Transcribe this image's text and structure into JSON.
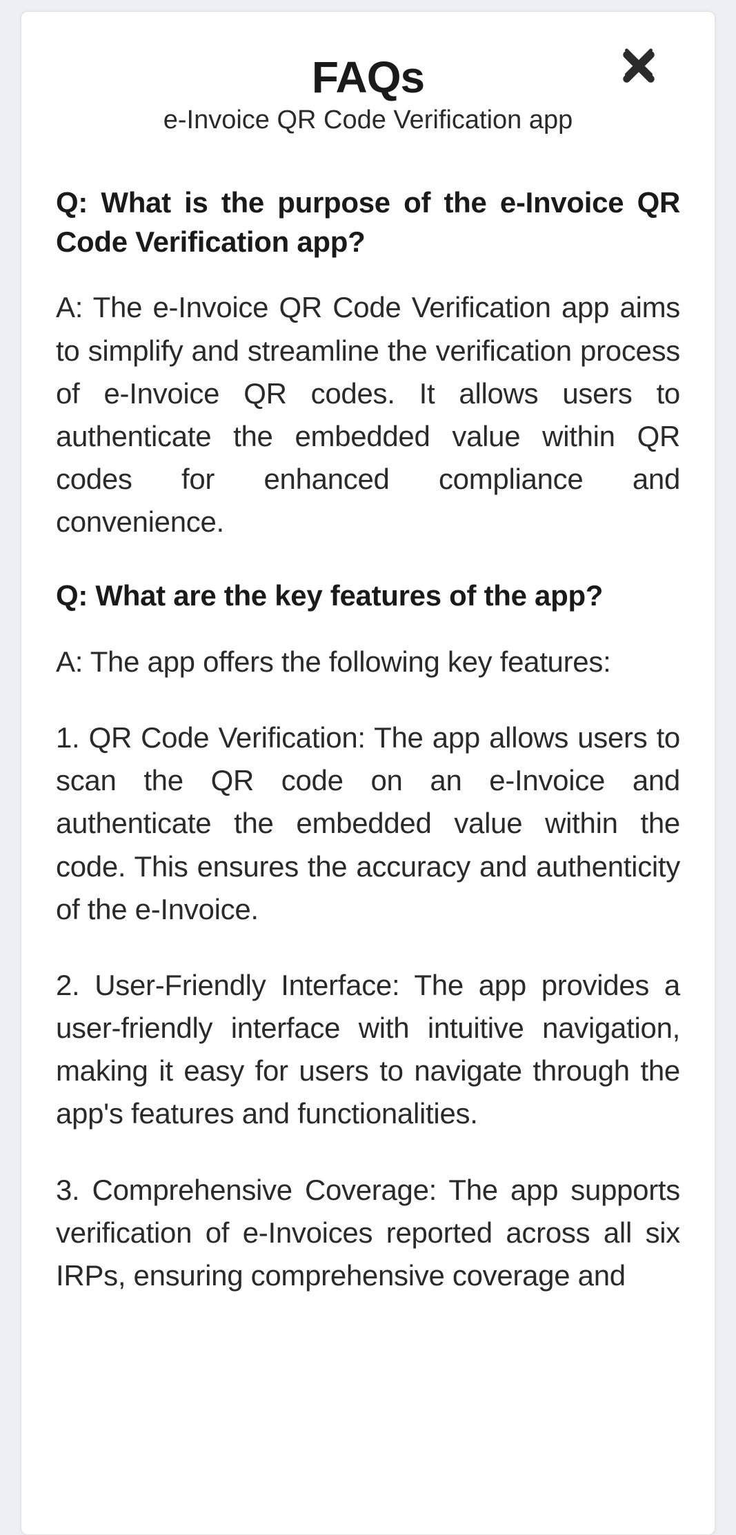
{
  "modal": {
    "title": "FAQs",
    "subtitle": "e-Invoice QR Code Verification app",
    "q1": "Q: What is the purpose of the e-Invoice QR Code Verification app?",
    "a1": "A: The e-Invoice QR Code Verification app aims to simplify and streamline the verification process of e-Invoice QR codes. It allows users to authenticate the embedded value within QR codes for enhanced compliance and convenience.",
    "q2": "Q: What are the key features of the app?",
    "a2_intro": "A: The app offers the following key features:",
    "a2_item1": "1. QR Code Verification: The app allows users to scan the QR code on an e-Invoice and authenticate the embedded value within the code. This ensures the accuracy and authenticity of the e-Invoice.",
    "a2_item2": "2. User-Friendly Interface: The app provides a user-friendly interface with intuitive navigation, making it easy for users to navigate through the app's features and functionalities.",
    "a2_item3": "3. Comprehensive Coverage: The app supports verification of e-Invoices reported across all six IRPs, ensuring comprehensive coverage and"
  }
}
